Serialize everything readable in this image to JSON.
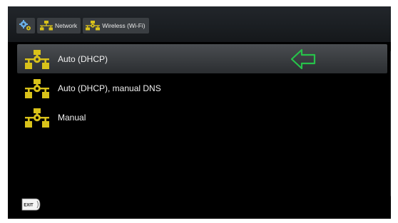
{
  "breadcrumb": {
    "items": [
      {
        "label": ""
      },
      {
        "label": "Network"
      },
      {
        "label": "Wireless (Wi-Fi)"
      }
    ]
  },
  "menu": {
    "items": [
      {
        "label": "Auto (DHCP)",
        "selected": true
      },
      {
        "label": "Auto (DHCP), manual DNS",
        "selected": false
      },
      {
        "label": "Manual",
        "selected": false
      }
    ]
  },
  "footer": {
    "exit_label": "EXIT"
  },
  "colors": {
    "icon_yellow": "#d9c21a",
    "arrow_green": "#27c24a",
    "background": "#000000"
  },
  "icons": [
    "settings-gears-icon",
    "network-icon",
    "network-gear-icon",
    "green-left-arrow-icon",
    "exit-icon"
  ]
}
